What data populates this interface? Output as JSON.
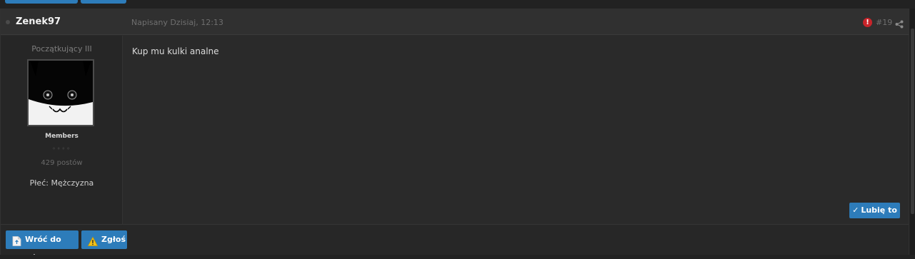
{
  "post": {
    "author": {
      "username": "Zenek97",
      "rank": "Początkujący III",
      "group": "Members",
      "pips": "◦◦◦◦",
      "post_count": "429 postów",
      "gender": "Płeć: Mężczyzna"
    },
    "header": {
      "posted": "Napisany Dzisiaj, 12:13",
      "post_number": "#19",
      "report_glyph": "!"
    },
    "body": "Kup mu kulki analne",
    "like_label": "Lubię to",
    "footer": {
      "back_to_top_label": "Wróć do góry",
      "report_label": "Zgłoś"
    }
  },
  "colors": {
    "accent": "#2d7cba",
    "report_red": "#c8242a",
    "background": "#222222",
    "post_bg": "#2a2a2a"
  },
  "icons": [
    "online-status-icon",
    "report-icon",
    "share-icon",
    "check-icon",
    "document-icon",
    "warning-icon"
  ]
}
